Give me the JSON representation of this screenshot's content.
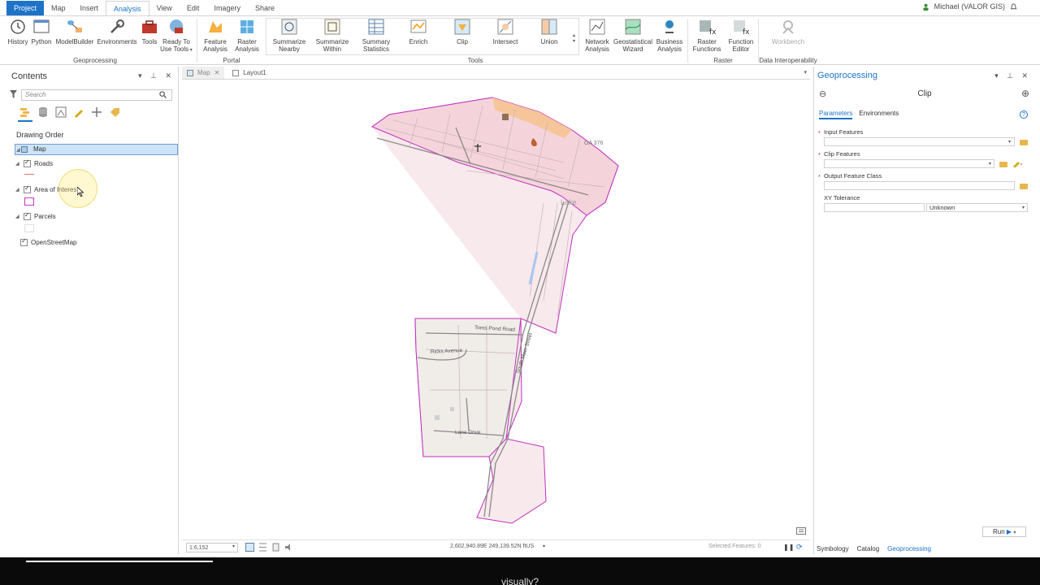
{
  "ribbon_tabs": [
    "Project",
    "Map",
    "Insert",
    "Analysis",
    "View",
    "Edit",
    "Imagery",
    "Share"
  ],
  "active_tab": "Analysis",
  "user": "Michael (VALOR GIS)",
  "ribbon": {
    "geoprocessing": {
      "label": "Geoprocessing",
      "buttons": [
        "History",
        "Python",
        "ModelBuilder",
        "Environments",
        "Tools",
        "Ready To Use Tools"
      ]
    },
    "portal": {
      "label": "Portal",
      "buttons": [
        "Feature Analysis",
        "Raster Analysis"
      ]
    },
    "tools": {
      "label": "Tools",
      "buttons": [
        "Summarize Nearby",
        "Summarize Within",
        "Summary Statistics",
        "Enrich",
        "Clip",
        "Intersect",
        "Union"
      ]
    },
    "more": [
      "Network Analysis",
      "Geostatistical Wizard",
      "Business Analysis"
    ],
    "raster": {
      "label": "Raster",
      "buttons": [
        "Raster Functions",
        "Function Editor"
      ]
    },
    "interop": {
      "label": "Data Interoperability",
      "buttons": [
        "Workbench"
      ]
    }
  },
  "contents": {
    "title": "Contents",
    "search_placeholder": "Search",
    "drawing_order": "Drawing Order",
    "map": "Map",
    "layers": [
      "Roads",
      "Area of Interest",
      "Parcels",
      "OpenStreetMap"
    ]
  },
  "map_view": {
    "tabs": [
      "Map",
      "Layout1"
    ],
    "scale": "1:6,152",
    "coordinates": "2,602,940.89E 249,139.52N ftUS",
    "selected_features": "Selected Features: 0",
    "labels": {
      "road1": "Toms Pond Road",
      "road2": "Ricks Avenue",
      "road3": "Lane Drive",
      "road4": "South Main Street",
      "lake": "Lake",
      "ga": "GA 376"
    }
  },
  "geoprocessing": {
    "title": "Geoprocessing",
    "tool": "Clip",
    "tabs": [
      "Parameters",
      "Environments"
    ],
    "params": {
      "input": "Input Features",
      "clip": "Clip Features",
      "output": "Output Feature Class",
      "xy": "XY Tolerance",
      "unit": "Unknown"
    },
    "run": "Run",
    "bottom_tabs": [
      "Symbology",
      "Catalog",
      "Geoprocessing"
    ]
  },
  "caption": "visually?"
}
